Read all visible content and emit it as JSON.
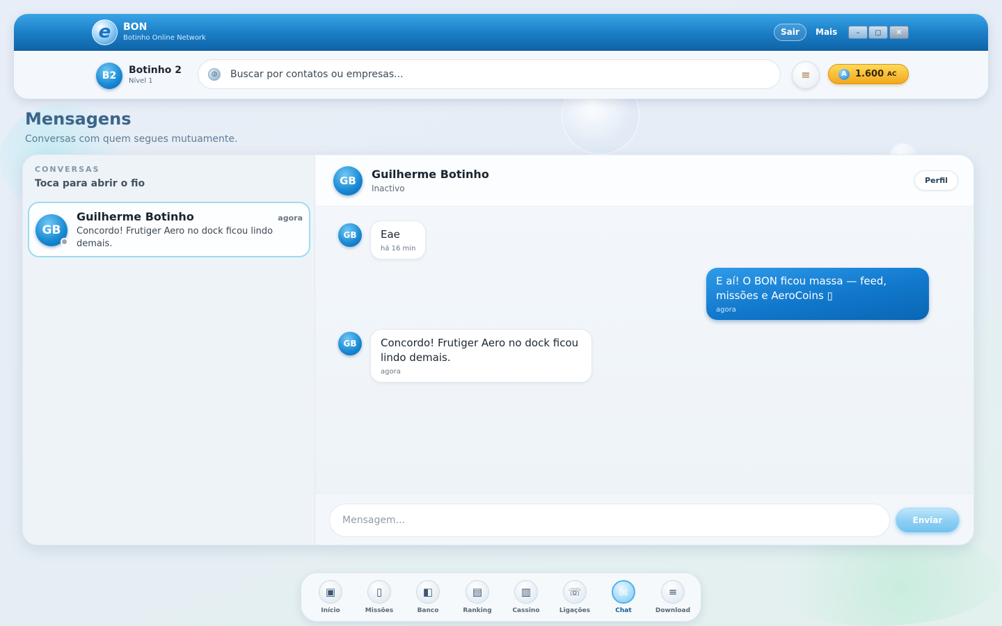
{
  "app": {
    "title": "BON",
    "subtitle": "Botinho Online Network",
    "logo_letter": "e"
  },
  "titlebar": {
    "sair_label": "Sair",
    "mais_label": "Mais",
    "min_glyph": "–",
    "max_glyph": "◻",
    "close_glyph": "✕"
  },
  "profile": {
    "initials": "B2",
    "name": "Botinho 2",
    "level": "Nível 1"
  },
  "search": {
    "placeholder": "Buscar por contatos ou empresas..."
  },
  "coins": {
    "symbol": "A",
    "value": "1.600",
    "unit": "AC"
  },
  "page": {
    "title": "Mensagens",
    "subtitle": "Conversas com quem segues mutuamente."
  },
  "sidebar": {
    "kicker": "CONVERSAS",
    "title": "Toca para abrir o fio",
    "conversations": [
      {
        "initials": "GB",
        "name": "Guilherme Botinho",
        "time": "agora",
        "preview": "Concordo! Frutiger Aero no dock ficou lindo demais."
      }
    ]
  },
  "chat": {
    "contact_initials": "GB",
    "contact_name": "Guilherme Botinho",
    "contact_status": "Inactivo",
    "profile_button": "Perfil",
    "messages": [
      {
        "from": "them",
        "initials": "GB",
        "text": "Eae",
        "time": "há 16 min"
      },
      {
        "from": "me",
        "text": "E aí! O BON ficou massa — feed, missões e AeroCoins ▯",
        "time": "agora"
      },
      {
        "from": "them",
        "initials": "GB",
        "text": "Concordo! Frutiger Aero no dock ficou lindo demais.",
        "time": "agora"
      }
    ],
    "input_placeholder": "Mensagem...",
    "send_label": "Enviar"
  },
  "dock": {
    "items": [
      {
        "label": "Início",
        "icon": "home-monitor-icon",
        "glyph": "▣"
      },
      {
        "label": "Missões",
        "icon": "phone-icon",
        "glyph": "▯"
      },
      {
        "label": "Banco",
        "icon": "bank-icon",
        "glyph": "◧"
      },
      {
        "label": "Ranking",
        "icon": "ranking-icon",
        "glyph": "▤"
      },
      {
        "label": "Cassino",
        "icon": "casino-icon",
        "glyph": "▥"
      },
      {
        "label": "Ligações",
        "icon": "calls-icon",
        "glyph": "☏"
      },
      {
        "label": "Chat",
        "icon": "chat-mail-icon",
        "glyph": "✉"
      },
      {
        "label": "Download",
        "icon": "download-bench-icon",
        "glyph": "≡"
      }
    ],
    "active": "Chat"
  },
  "colors": {
    "accent": "#1788d3",
    "titlebar": "#1c80c9",
    "coin": "#f2a81d",
    "send": "#8fd0f4"
  }
}
